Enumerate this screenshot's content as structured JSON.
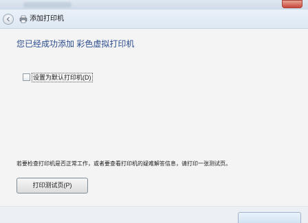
{
  "nav": {
    "title": "添加打印机"
  },
  "main": {
    "heading": "您已经成功添加 彩色虚拟打印机",
    "default_checkbox_label": "设置为默认打印机(D)",
    "default_checkbox_checked": false,
    "info_text": "若要检查打印机是否正常工作，或者要查看打印机的疑难解答信息，请打印一张测试页。",
    "test_page_button": "打印测试页(P)"
  },
  "colors": {
    "heading": "#2a4b8d",
    "close_button": "#c8493a"
  },
  "icons": {
    "back": "back-arrow-icon",
    "printer": "printer-icon",
    "close": "close-icon"
  }
}
